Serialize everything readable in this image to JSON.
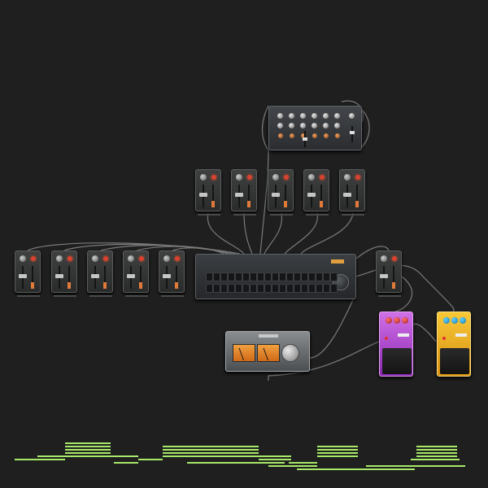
{
  "canvas": {
    "background": "#1f1f1f"
  },
  "colors": {
    "cable": "#7a7a7a",
    "sequencer_note": "#a8e868",
    "pedal_purple": "#b84ad8",
    "pedal_yellow": "#f0b020",
    "vu_orange": "#e88a30",
    "led_red": "#d8412f"
  },
  "devices": {
    "top_mixer": {
      "icon": "mixer-icon"
    },
    "main_console": {
      "icon": "console-icon"
    },
    "vu_amp": {
      "icon": "vu-meter-icon"
    },
    "pedals": [
      {
        "color": "purple",
        "icon": "distortion-pedal-icon"
      },
      {
        "color": "yellow",
        "icon": "overdrive-pedal-icon"
      }
    ],
    "strip_count": 11
  }
}
